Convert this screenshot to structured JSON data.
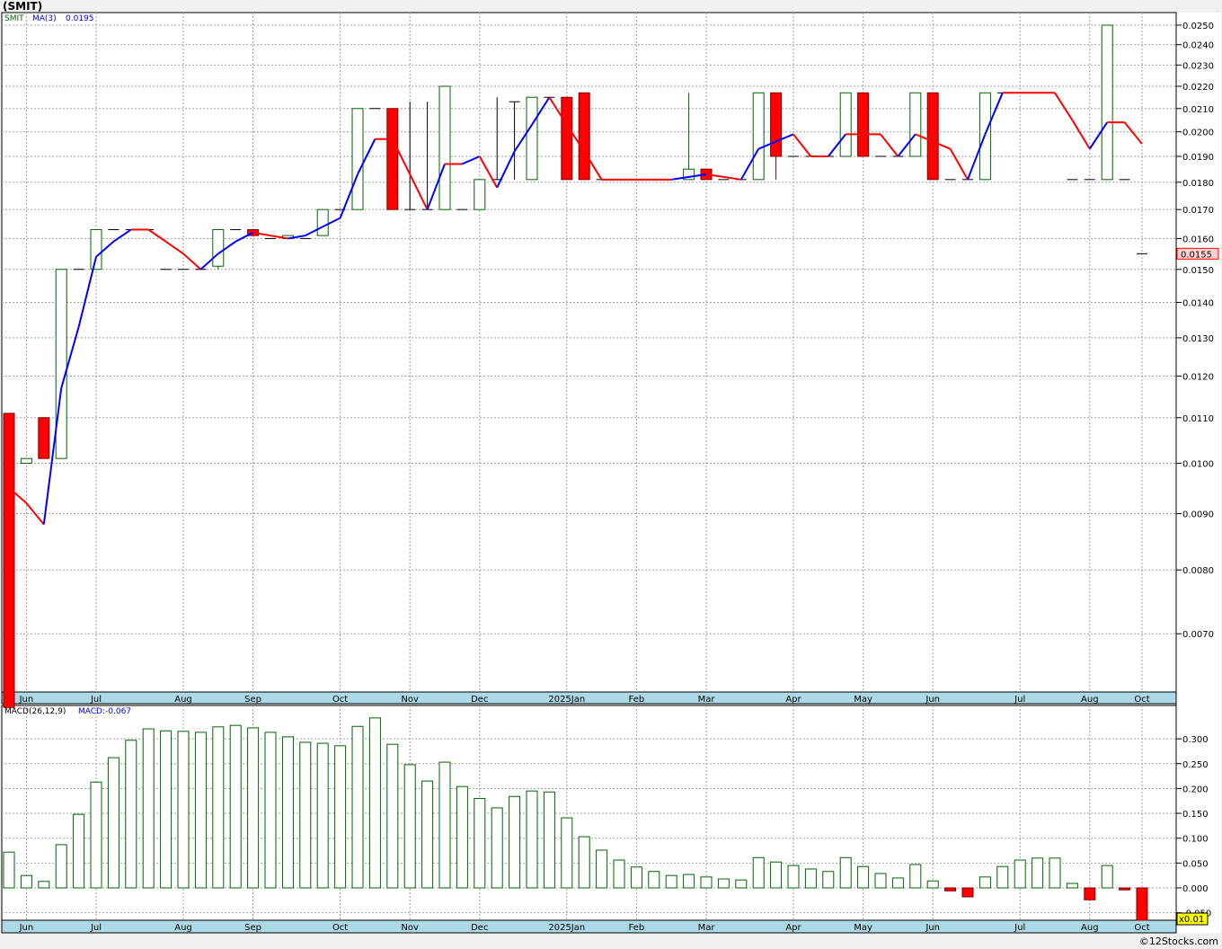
{
  "header": {
    "title": "(SMIT)",
    "credit": "©12Stocks.com"
  },
  "legend": {
    "symbol": "SMIT",
    "ma_label": "MA(3)",
    "ma_value": "0.0195",
    "macd_label": "MACD(26,12,9)",
    "macd_value": "MACD:-0.067"
  },
  "colors": {
    "up": "#006400",
    "down": "#ff0000",
    "flat": "#000000",
    "ma_up": "#0000ff",
    "ma_down": "#ff0000",
    "axis_band": "#add8e6",
    "grid": "#a0a0a0"
  },
  "chart_data": [
    {
      "type": "candlestick",
      "title": "",
      "yscale": "log",
      "ylim": [
        0.0062,
        0.0262
      ],
      "grid": true,
      "y_ticks": [
        "0.0250",
        "0.0240",
        "0.0230",
        "0.0220",
        "0.0210",
        "0.0200",
        "0.0190",
        "0.0180",
        "0.0170",
        "0.0160",
        "0.0150",
        "0.0140",
        "0.0130",
        "0.0120",
        "0.0110",
        "0.0100",
        "0.0090",
        "0.0080",
        "0.0070"
      ],
      "x_ticks": [
        {
          "label": "Jun",
          "week": 1
        },
        {
          "label": "Jul",
          "week": 5
        },
        {
          "label": "Aug",
          "week": 10
        },
        {
          "label": "Sep",
          "week": 14
        },
        {
          "label": "Oct",
          "week": 19
        },
        {
          "label": "Nov",
          "week": 23
        },
        {
          "label": "Dec",
          "week": 27
        },
        {
          "label": "2025Jan",
          "week": 32
        },
        {
          "label": "Feb",
          "week": 36
        },
        {
          "label": "Mar",
          "week": 40
        },
        {
          "label": "Apr",
          "week": 45
        },
        {
          "label": "May",
          "week": 49
        },
        {
          "label": "Jun",
          "week": 53
        },
        {
          "label": "Jul",
          "week": 58
        },
        {
          "label": "Aug",
          "week": 62
        },
        {
          "label": "Oct",
          "week": 65
        }
      ],
      "last_price": "0.0155",
      "candles": [
        [
          0.0111,
          0.0111,
          0.006,
          0.006
        ],
        [
          0.01,
          0.0101,
          0.01,
          0.0101
        ],
        [
          0.011,
          0.011,
          0.0101,
          0.0101
        ],
        [
          0.0101,
          0.015,
          0.0101,
          0.015
        ],
        [
          0.015,
          0.015,
          0.015,
          0.015
        ],
        [
          0.015,
          0.0163,
          0.015,
          0.0163
        ],
        [
          0.0163,
          0.0163,
          0.0163,
          0.0163
        ],
        [
          0.0163,
          0.0163,
          0.0163,
          0.0163
        ],
        [
          0.0163,
          0.0163,
          0.0163,
          0.0163
        ],
        [
          0.015,
          0.015,
          0.015,
          0.015
        ],
        [
          0.015,
          0.015,
          0.015,
          0.015
        ],
        [
          0.015,
          0.015,
          0.015,
          0.015
        ],
        [
          0.0151,
          0.0163,
          0.015,
          0.0163
        ],
        [
          0.0163,
          0.0163,
          0.0163,
          0.0163
        ],
        [
          0.0163,
          0.0163,
          0.0161,
          0.0161
        ],
        [
          0.016,
          0.016,
          0.016,
          0.016
        ],
        [
          0.016,
          0.0161,
          0.016,
          0.0161
        ],
        [
          0.016,
          0.016,
          0.016,
          0.016
        ],
        [
          0.0161,
          0.017,
          0.0161,
          0.017
        ],
        [
          0.017,
          0.017,
          0.017,
          0.017
        ],
        [
          0.017,
          0.021,
          0.017,
          0.021
        ],
        [
          0.021,
          0.021,
          0.021,
          0.021
        ],
        [
          0.021,
          0.021,
          0.017,
          0.017
        ],
        [
          0.017,
          0.0213,
          0.017,
          0.017
        ],
        [
          0.017,
          0.0213,
          0.017,
          0.017
        ],
        [
          0.017,
          0.022,
          0.017,
          0.022
        ],
        [
          0.017,
          0.017,
          0.017,
          0.017
        ],
        [
          0.017,
          0.0181,
          0.017,
          0.0181
        ],
        [
          0.0181,
          0.0215,
          0.0181,
          0.0181
        ],
        [
          0.0213,
          0.0213,
          0.0181,
          0.0213
        ],
        [
          0.0181,
          0.0215,
          0.0181,
          0.0215
        ],
        [
          0.0215,
          0.0215,
          0.0215,
          0.0215
        ],
        [
          0.0215,
          0.0215,
          0.0181,
          0.0181
        ],
        [
          0.0217,
          0.0217,
          0.0181,
          0.0181
        ],
        [
          0.0181,
          0.0181,
          0.0181,
          0.0181
        ],
        null,
        null,
        null,
        null,
        [
          0.0181,
          0.0217,
          0.0181,
          0.0185
        ],
        [
          0.0185,
          0.0185,
          0.0181,
          0.0181
        ],
        [
          0.0181,
          0.0181,
          0.0181,
          0.0181
        ],
        [
          0.0181,
          0.0181,
          0.0181,
          0.0181
        ],
        [
          0.0181,
          0.0217,
          0.0181,
          0.0217
        ],
        [
          0.0217,
          0.0217,
          0.0181,
          0.019
        ],
        [
          0.019,
          0.019,
          0.019,
          0.019
        ],
        [
          0.019,
          0.019,
          0.019,
          0.019
        ],
        [
          0.019,
          0.019,
          0.019,
          0.019
        ],
        [
          0.019,
          0.0217,
          0.019,
          0.0217
        ],
        [
          0.0217,
          0.0217,
          0.019,
          0.019
        ],
        [
          0.019,
          0.019,
          0.019,
          0.019
        ],
        [
          0.019,
          0.019,
          0.019,
          0.019
        ],
        [
          0.019,
          0.0217,
          0.019,
          0.0217
        ],
        [
          0.0217,
          0.0217,
          0.0181,
          0.0181
        ],
        [
          0.0181,
          0.0181,
          0.0181,
          0.0181
        ],
        [
          0.0181,
          0.0181,
          0.0181,
          0.0181
        ],
        [
          0.0181,
          0.0217,
          0.0181,
          0.0217
        ],
        [
          0.0217,
          0.0217,
          0.0217,
          0.0217
        ],
        [
          0.0217,
          0.0217,
          0.0217,
          0.0217
        ],
        null,
        null,
        [
          0.0181,
          0.0181,
          0.0181,
          0.0181
        ],
        [
          0.0181,
          0.0181,
          0.0181,
          0.0181
        ],
        [
          0.0181,
          0.025,
          0.0181,
          0.025
        ],
        [
          0.0181,
          0.0181,
          0.0181,
          0.0181
        ],
        [
          0.0155,
          0.0155,
          0.0155,
          0.0155
        ]
      ],
      "ma3": [
        0.0095,
        0.0092,
        0.0088,
        0.0117,
        0.0133,
        0.0154,
        0.0159,
        0.0163,
        0.0163,
        0.0159,
        0.0155,
        0.015,
        0.0155,
        0.0159,
        0.0162,
        0.0161,
        0.016,
        0.0161,
        0.0164,
        0.0167,
        0.0183,
        0.0197,
        0.0197,
        0.0183,
        0.017,
        0.0187,
        0.0187,
        0.019,
        0.0178,
        0.0192,
        0.0203,
        0.0215,
        0.0203,
        0.0192,
        0.0181,
        0.0181,
        0.0181,
        0.0181,
        0.0181,
        0.0182,
        0.0183,
        0.0182,
        0.0181,
        0.0193,
        0.0196,
        0.0199,
        0.019,
        0.019,
        0.0199,
        0.0199,
        0.0199,
        0.019,
        0.0199,
        0.0196,
        0.0193,
        0.0181,
        0.0199,
        0.0217,
        0.0217,
        0.0217,
        0.0217,
        0.0205,
        0.0193,
        0.0204,
        0.0204,
        0.0195
      ]
    },
    {
      "type": "bar",
      "title": "",
      "ylim": [
        -0.065,
        0.367
      ],
      "grid": true,
      "y_ticks": [
        "0.300",
        "0.250",
        "0.200",
        "0.150",
        "0.100",
        "0.050",
        "0.000",
        "-0.050"
      ],
      "scale_note": "x0.01",
      "values": [
        0.072,
        0.025,
        0.013,
        0.087,
        0.148,
        0.213,
        0.262,
        0.297,
        0.32,
        0.316,
        0.315,
        0.313,
        0.324,
        0.327,
        0.322,
        0.313,
        0.304,
        0.293,
        0.291,
        0.286,
        0.325,
        0.342,
        0.289,
        0.248,
        0.215,
        0.253,
        0.204,
        0.18,
        0.161,
        0.184,
        0.195,
        0.193,
        0.141,
        0.103,
        0.076,
        0.056,
        0.042,
        0.033,
        0.025,
        0.027,
        0.022,
        0.018,
        0.016,
        0.061,
        0.052,
        0.045,
        0.038,
        0.033,
        0.061,
        0.043,
        0.029,
        0.02,
        0.047,
        0.014,
        -0.006,
        -0.018,
        0.022,
        0.043,
        0.056,
        0.06,
        0.06,
        0.009,
        -0.024,
        0.045,
        -0.004,
        -0.067
      ]
    }
  ]
}
